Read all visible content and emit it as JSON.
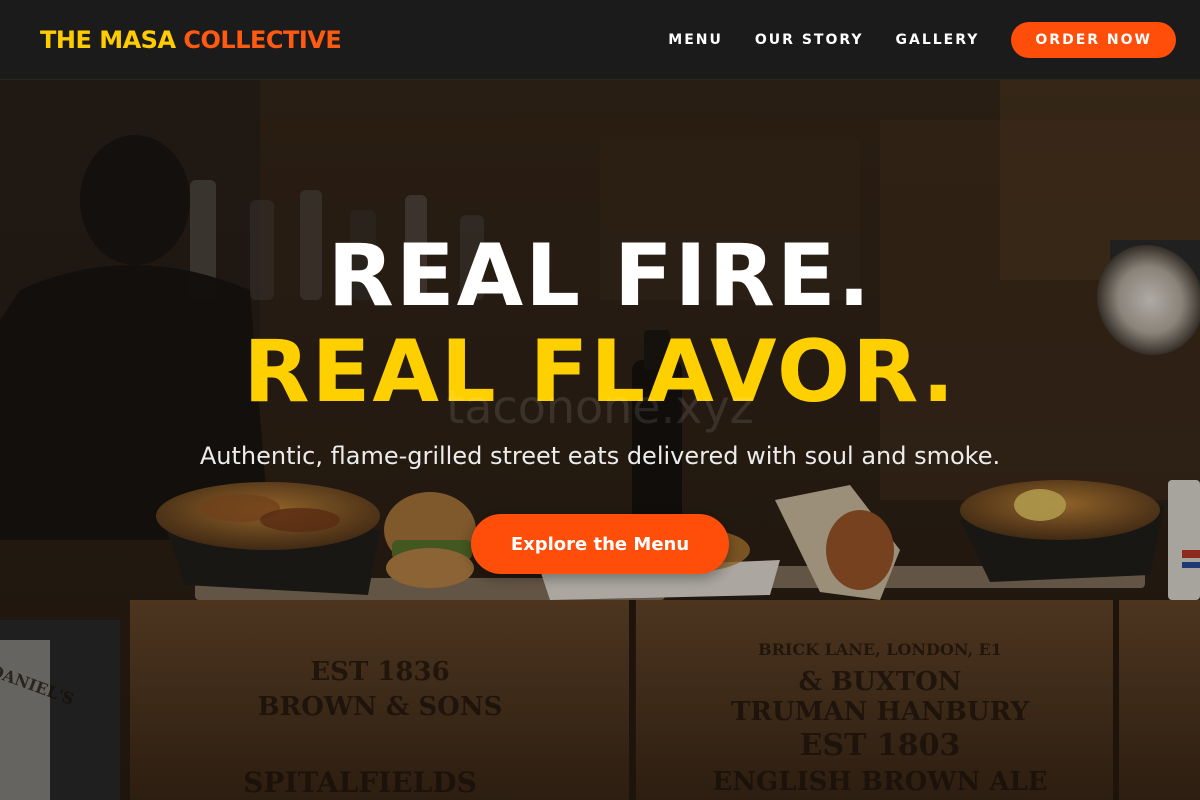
{
  "header": {
    "logo_part1": "THE MASA",
    "logo_part2": "COLLECTIVE",
    "nav": [
      {
        "label": "MENU"
      },
      {
        "label": "OUR STORY"
      },
      {
        "label": "GALLERY"
      }
    ],
    "order_label": "ORDER NOW"
  },
  "hero": {
    "headline_line1": "REAL FIRE.",
    "headline_line2": "REAL FLAVOR.",
    "watermark": "taconone.xyz",
    "tagline": "Authentic, flame-grilled street eats delivered with soul and smoke.",
    "cta_label": "Explore the Menu",
    "background_icon": "food-counter-photo",
    "crate_text_left": [
      "EST 1836",
      "BROWN & SONS",
      "SPITALFIELDS"
    ],
    "crate_text_right": [
      "BRICK LANE, LONDON, E1",
      "& BUXTON",
      "TRUMAN HANBURY",
      "EST 1803",
      "ENGLISH BROWN ALE"
    ],
    "bottle_label": "DANIEL'S"
  },
  "colors": {
    "brand_yellow": "#ffcc00",
    "brand_orange": "#ff5a12",
    "accent_button": "#ff4d0a",
    "header_bg": "#1b1b1b",
    "headline_yellow": "#ffd000"
  }
}
